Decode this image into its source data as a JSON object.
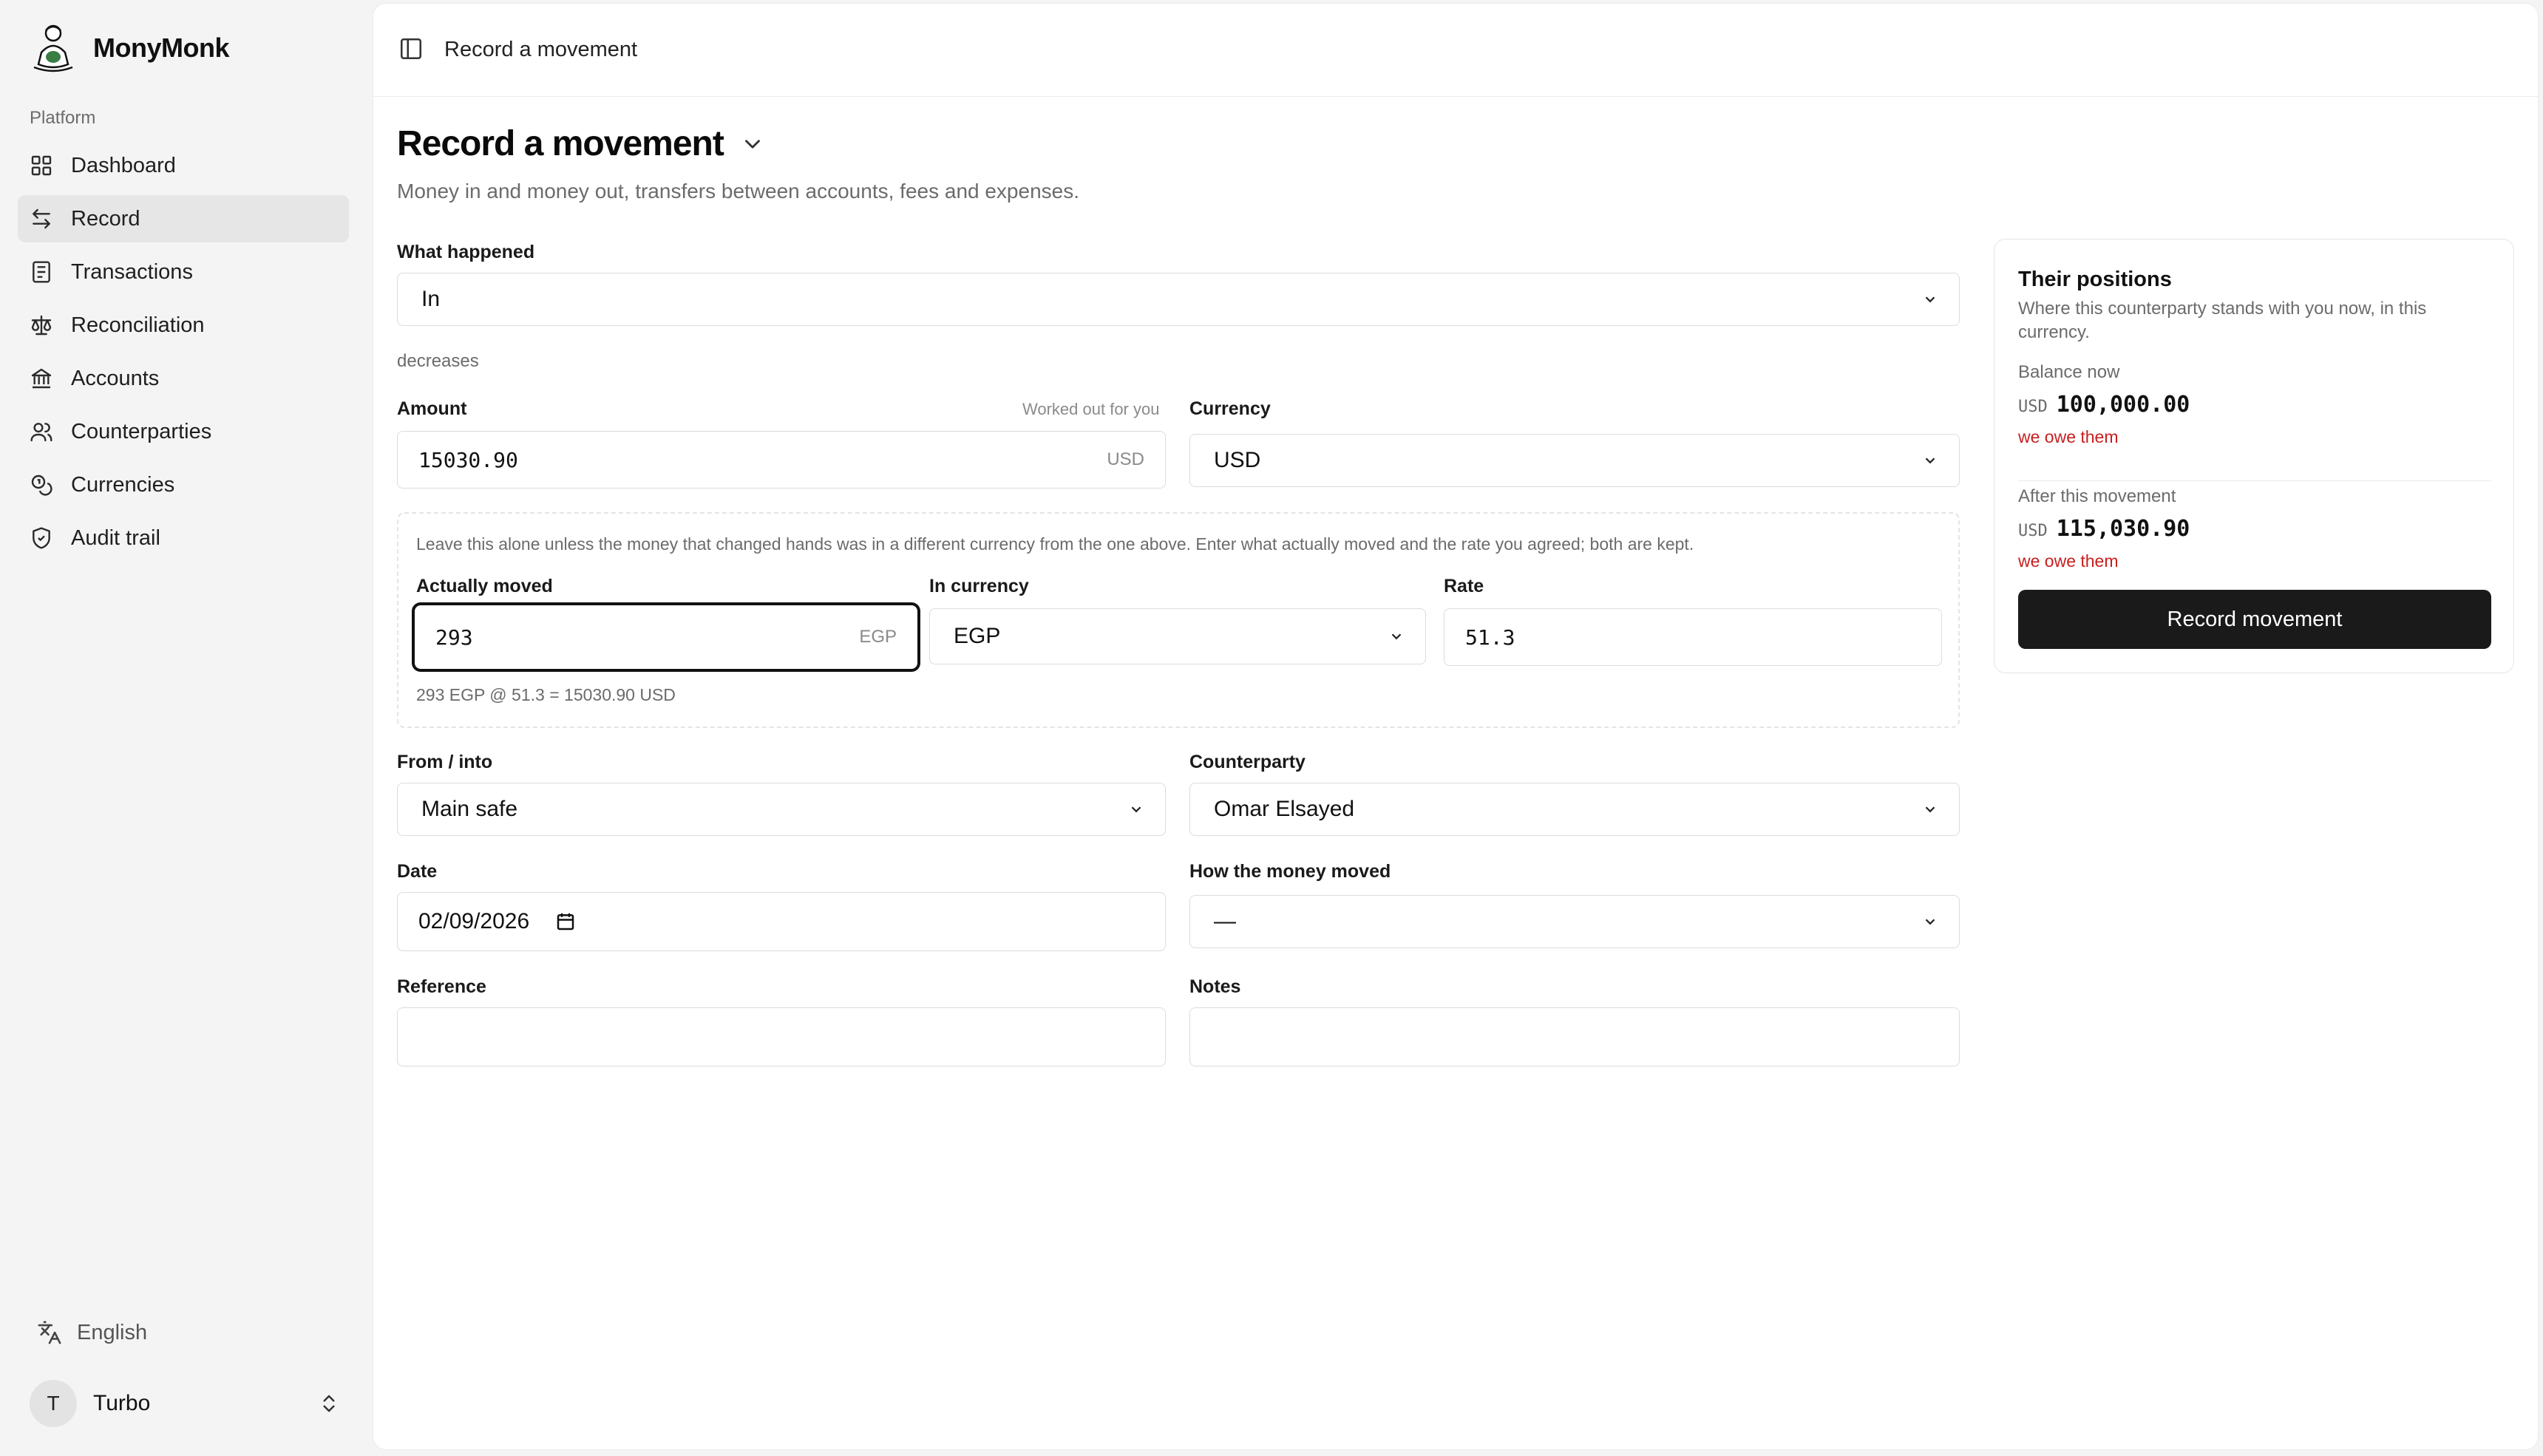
{
  "brand": {
    "name": "MonyMonk"
  },
  "sidebar": {
    "section": "Platform",
    "items": [
      {
        "label": "Dashboard",
        "icon": "grid-icon"
      },
      {
        "label": "Record",
        "icon": "arrows-left-right-icon"
      },
      {
        "label": "Transactions",
        "icon": "receipt-icon"
      },
      {
        "label": "Reconciliation",
        "icon": "scale-icon"
      },
      {
        "label": "Accounts",
        "icon": "bank-icon"
      },
      {
        "label": "Counterparties",
        "icon": "users-icon"
      },
      {
        "label": "Currencies",
        "icon": "coins-icon"
      },
      {
        "label": "Audit trail",
        "icon": "shield-icon"
      }
    ],
    "active_item": "Record",
    "language": "English",
    "user": {
      "initial": "T",
      "name": "Turbo"
    }
  },
  "topbar": {
    "title": "Record a movement"
  },
  "page": {
    "title": "Record a movement",
    "subtitle": "Money in and money out, transfers between accounts, fees and expenses."
  },
  "form": {
    "what_happened": {
      "label": "What happened",
      "value": "In"
    },
    "direction_note": "decreases",
    "amount": {
      "label": "Amount",
      "hint": "Worked out for you",
      "value": "15030.90",
      "suffix": "USD"
    },
    "currency": {
      "label": "Currency",
      "value": "USD"
    },
    "fx": {
      "help": "Leave this alone unless the money that changed hands was in a different currency from the one above. Enter what actually moved and the rate you agreed; both are kept.",
      "actually_moved": {
        "label": "Actually moved",
        "value": "293",
        "suffix": "EGP"
      },
      "in_currency": {
        "label": "In currency",
        "value": "EGP"
      },
      "rate": {
        "label": "Rate",
        "value": "51.3"
      },
      "summary": "293 EGP @ 51.3 = 15030.90 USD"
    },
    "from_into": {
      "label": "From / into",
      "value": "Main safe"
    },
    "counterparty": {
      "label": "Counterparty",
      "value": "Omar Elsayed"
    },
    "date": {
      "label": "Date",
      "value": "02/09/2026"
    },
    "how_moved": {
      "label": "How the money moved",
      "value": "—"
    },
    "reference": {
      "label": "Reference",
      "value": ""
    },
    "notes": {
      "label": "Notes",
      "value": ""
    }
  },
  "positions": {
    "title": "Their positions",
    "description": "Where this counterparty stands with you now, in this currency.",
    "balance_now": {
      "label": "Balance now",
      "currency": "USD",
      "amount": "100,000.00",
      "status": "we owe them"
    },
    "after": {
      "label": "After this movement",
      "currency": "USD",
      "amount": "115,030.90",
      "status": "we owe them"
    },
    "button": "Record movement"
  },
  "colors": {
    "accent": "#1a1a1a",
    "debt_status": "#c81e1e",
    "active_nav": "#e6e6e6"
  }
}
